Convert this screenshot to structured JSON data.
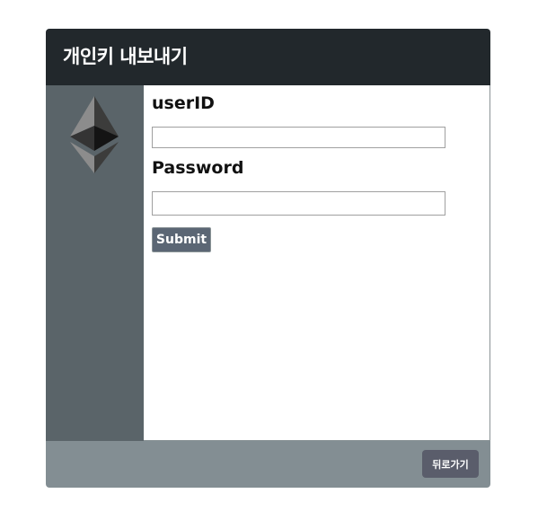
{
  "header": {
    "title": "개인키 내보내기"
  },
  "sidebar": {
    "logo_icon": "ethereum-icon"
  },
  "form": {
    "userid_label": "userID",
    "userid_value": "",
    "password_label": "Password",
    "password_value": "",
    "submit_label": "Submit"
  },
  "footer": {
    "back_label": "뒤로가기"
  },
  "colors": {
    "header_bg": "#22282c",
    "sidebar_bg": "#5a6469",
    "footer_bg": "#838e93",
    "submit_bg": "#5b6674",
    "back_button_bg": "#5a5d6b"
  }
}
